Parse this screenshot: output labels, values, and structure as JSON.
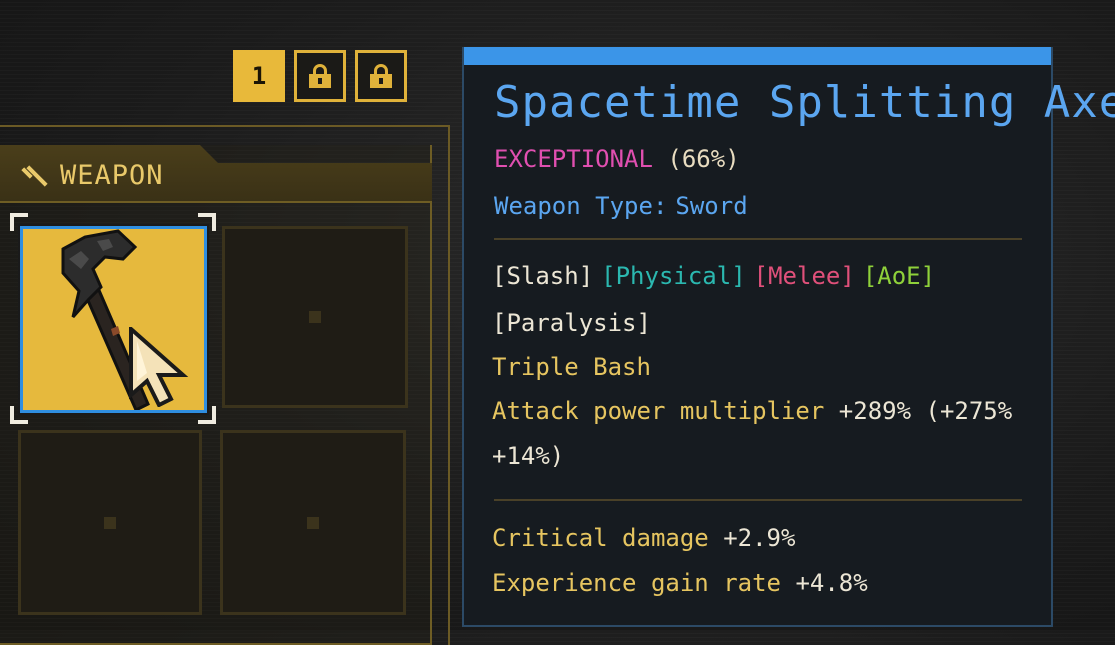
{
  "loadout_tabs": {
    "active_label": "1",
    "locked_icon": "lock-icon"
  },
  "weapon_panel": {
    "title": "WEAPON",
    "icon": "sword-icon",
    "selected_item_icon": "axe-icon",
    "colors": {
      "gold": "#e6b93d",
      "selection": "#2f8ee0"
    }
  },
  "tooltip": {
    "name": "Spacetime Splitting Axe",
    "rarity_label": "EXCEPTIONAL",
    "rarity_percent": "(66%)",
    "weapon_type_label": "Weapon Type:",
    "weapon_type_value": "Sword",
    "tags": [
      {
        "text": "[Slash]",
        "color": "#ece6d5"
      },
      {
        "text": "[Physical]",
        "color": "#2bb8b0"
      },
      {
        "text": "[Melee]",
        "color": "#e0507a"
      },
      {
        "text": "[AoE]",
        "color": "#8fd13a"
      }
    ],
    "tag_line2": "[Paralysis]",
    "skill": "Triple Bash",
    "attack_label": "Attack power multiplier",
    "attack_value": "+289% (+275%",
    "attack_value_cont": "+14%)",
    "stats": [
      {
        "label": "Critical damage",
        "value": "+2.9%"
      },
      {
        "label": "Experience gain rate",
        "value": "+4.8%"
      }
    ],
    "colors": {
      "header_bar": "#3b95e8",
      "name": "#5ba6f0",
      "rarity": "#e04fb0"
    }
  }
}
